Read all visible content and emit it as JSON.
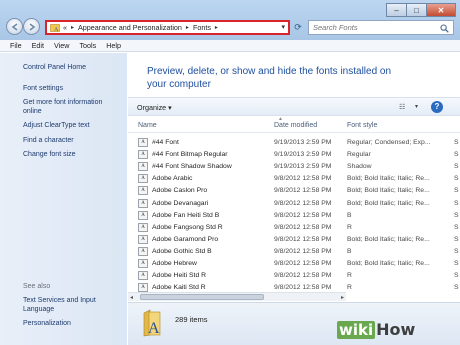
{
  "address": {
    "segments": [
      "Appearance and Personalization",
      "Fonts"
    ],
    "back_chevrons": "«"
  },
  "search": {
    "placeholder": "Search Fonts"
  },
  "menu": [
    "File",
    "Edit",
    "View",
    "Tools",
    "Help"
  ],
  "left_pane": {
    "links": [
      "Control Panel Home",
      "Font settings",
      "Get more font information online",
      "Adjust ClearType text",
      "Find a character",
      "Change font size"
    ],
    "see_also_heading": "See also",
    "see_also_links": [
      "Text Services and Input Language",
      "Personalization"
    ]
  },
  "header": {
    "text": "Preview, delete, or show and hide the fonts installed on your computer"
  },
  "toolbar": {
    "organize": "Organize"
  },
  "columns": {
    "name": "Name",
    "date": "Date modified",
    "style": "Font style"
  },
  "fonts": [
    {
      "name": "#44 Font",
      "date": "9/19/2013 2:59 PM",
      "style": "Regular; Condensed; Exp...",
      "show": "S"
    },
    {
      "name": "#44 Font Bitmap Regular",
      "date": "9/19/2013 2:59 PM",
      "style": "Regular",
      "show": "S"
    },
    {
      "name": "#44 Font Shadow Shadow",
      "date": "9/19/2013 2:59 PM",
      "style": "Shadow",
      "show": "S"
    },
    {
      "name": "Adobe Arabic",
      "date": "9/8/2012 12:58 PM",
      "style": "Bold; Bold Italic; Italic; Re...",
      "show": "S"
    },
    {
      "name": "Adobe Caslon Pro",
      "date": "9/8/2012 12:58 PM",
      "style": "Bold; Bold Italic; Italic; Re...",
      "show": "S"
    },
    {
      "name": "Adobe Devanagari",
      "date": "9/8/2012 12:58 PM",
      "style": "Bold; Bold Italic; Italic; Re...",
      "show": "S"
    },
    {
      "name": "Adobe Fan Heiti Std B",
      "date": "9/8/2012 12:58 PM",
      "style": "B",
      "show": "S"
    },
    {
      "name": "Adobe Fangsong Std R",
      "date": "9/8/2012 12:58 PM",
      "style": "R",
      "show": "S"
    },
    {
      "name": "Adobe Garamond Pro",
      "date": "9/8/2012 12:58 PM",
      "style": "Bold; Bold Italic; Italic; Re...",
      "show": "S"
    },
    {
      "name": "Adobe Gothic Std B",
      "date": "9/8/2012 12:58 PM",
      "style": "B",
      "show": "S"
    },
    {
      "name": "Adobe Hebrew",
      "date": "9/8/2012 12:58 PM",
      "style": "Bold; Bold Italic; Italic; Re...",
      "show": "S"
    },
    {
      "name": "Adobe Heiti Std R",
      "date": "9/8/2012 12:58 PM",
      "style": "R",
      "show": "S"
    },
    {
      "name": "Adobe Kaiti Std R",
      "date": "9/8/2012 12:58 PM",
      "style": "R",
      "show": "S"
    }
  ],
  "details": {
    "count": "289 items"
  },
  "watermark": {
    "part1": "wiki",
    "part2": "How"
  },
  "colors": {
    "highlight_border": "#d8242a",
    "link": "#1e3b6e",
    "header_text": "#1e4f9e"
  },
  "icons": [
    "back-arrow-icon",
    "forward-arrow-icon",
    "folder-fonts-icon",
    "refresh-icon",
    "search-icon",
    "help-icon",
    "font-file-icon"
  ]
}
